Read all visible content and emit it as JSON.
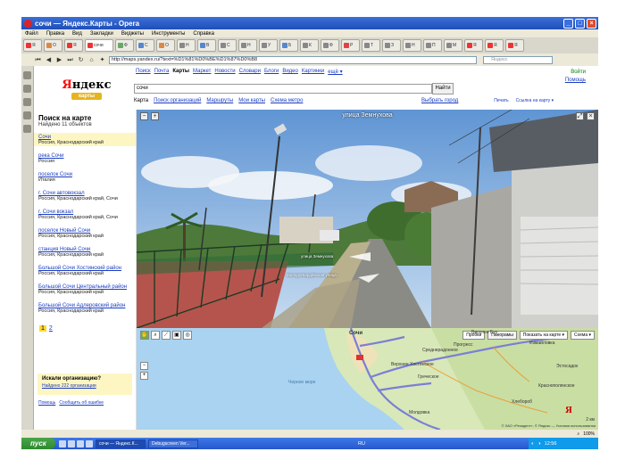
{
  "window": {
    "title": "сочи — Яндекс.Карты - Opera",
    "minimize": "_",
    "maximize": "□",
    "close": "×"
  },
  "menu": [
    "Файл",
    "Правка",
    "Вид",
    "Закладки",
    "Виджеты",
    "Инструменты",
    "Справка"
  ],
  "tabs": [
    {
      "label": "Я",
      "color": "#e33"
    },
    {
      "label": "О",
      "color": "#d84"
    },
    {
      "label": "Я",
      "color": "#e33"
    },
    {
      "label": "сочи",
      "color": "#e33",
      "active": true
    },
    {
      "label": "Ф",
      "color": "#6a6"
    },
    {
      "label": "С",
      "color": "#58c"
    },
    {
      "label": "О",
      "color": "#d84"
    },
    {
      "label": "Н",
      "color": "#888"
    },
    {
      "label": "В",
      "color": "#58c"
    },
    {
      "label": "С",
      "color": "#888"
    },
    {
      "label": "Н",
      "color": "#888"
    },
    {
      "label": "У",
      "color": "#888"
    },
    {
      "label": "Б",
      "color": "#58c"
    },
    {
      "label": "К",
      "color": "#888"
    },
    {
      "label": "Ф",
      "color": "#888"
    },
    {
      "label": "Р",
      "color": "#d44"
    },
    {
      "label": "Т",
      "color": "#888"
    },
    {
      "label": "З",
      "color": "#888"
    },
    {
      "label": "Н",
      "color": "#888"
    },
    {
      "label": "П",
      "color": "#888"
    },
    {
      "label": "М",
      "color": "#888"
    },
    {
      "label": "Я",
      "color": "#e33"
    },
    {
      "label": "Я",
      "color": "#e33"
    },
    {
      "label": "Я",
      "color": "#e33"
    }
  ],
  "nav": {
    "address": "http://maps.yandex.ru/?text=%D1%81%D0%BE%D1%87%D0%B8",
    "search_placeholder": "Яндекс"
  },
  "yandex": {
    "logo_ya": "Я",
    "logo_rest": "ндекс",
    "logo_sub": "карты",
    "services": [
      "Поиск",
      "Почта",
      "Карты",
      "Маркет",
      "Новости",
      "Словари",
      "Блоги",
      "Видео",
      "Картинки",
      "ещё ▾"
    ],
    "current_service": "Карты",
    "login": "Войти",
    "help": "Помощь",
    "query": "сочи",
    "find_button": "Найти",
    "subnav": [
      "Карта",
      "Поиск организаций",
      "Маршруты",
      "Мои карты",
      "Схема метро"
    ],
    "current_subnav": "Карта",
    "choose_city": "Выбрать город",
    "print": "Печать",
    "link": "Ссылка на карту ▾"
  },
  "results": {
    "title": "Поиск на карте",
    "found": "Найдено 11 объектов",
    "items": [
      {
        "name": "Сочи",
        "addr": "Россия, Краснодарский край",
        "selected": true
      },
      {
        "name": "река Сочи",
        "addr": "Россия"
      },
      {
        "name": "поселок Сочи",
        "addr": "Италия"
      },
      {
        "name": "г. Сочи автовокзал",
        "addr": "Россия, Краснодарский край, Сочи"
      },
      {
        "name": "г. Сочи вокзал",
        "addr": "Россия, Краснодарский край, Сочи"
      },
      {
        "name": "поселок Новый Сочи",
        "addr": "Россия, Краснодарский край"
      },
      {
        "name": "станция Новый Сочи",
        "addr": "Россия, Краснодарский край"
      },
      {
        "name": "Большой Сочи Хостинский район",
        "addr": "Россия, Краснодарский край"
      },
      {
        "name": "Большой Сочи Центральный район",
        "addr": "Россия, Краснодарский край"
      },
      {
        "name": "Большой Сочи Адлеровский район",
        "addr": "Россия, Краснодарский край"
      }
    ],
    "pages": [
      "1",
      "2"
    ],
    "org_title": "Искали организацию?",
    "org_link": "Найдено 222 организации",
    "footer": [
      "Помощь",
      "Сообщить об ошибке"
    ]
  },
  "panorama": {
    "street": "улица Земнухова",
    "arrow1": "улица Земнухова",
    "arrow2": "Молодогвардейская улица"
  },
  "map": {
    "layers": [
      "Пробки",
      "Панорамы",
      "Показать на карте ▾",
      "Схема ▾"
    ],
    "labels": [
      {
        "text": "Сочи",
        "city": true
      },
      {
        "text": "Прогресс"
      },
      {
        "text": "Измайловка"
      },
      {
        "text": "Верхнее Буу"
      },
      {
        "text": "Краснополянское"
      },
      {
        "text": "Хлебороб"
      },
      {
        "text": "Греческое"
      },
      {
        "text": "Среднерадонное"
      },
      {
        "text": "Молдовка"
      },
      {
        "text": "Эстосадок"
      },
      {
        "text": "Черное море"
      },
      {
        "text": "Верхнее Хостинское"
      }
    ],
    "scale": "2 км",
    "copyright": "© ЗАО «Резидент», © Яндекс — Условия использования"
  },
  "statusbar": {
    "zoom": "100%"
  },
  "taskbar": {
    "start": "пуск",
    "tasks": [
      "сочи — Яндекс.К...",
      "Debugscreen Ver..."
    ],
    "lang": "RU",
    "clock": "12:56"
  }
}
